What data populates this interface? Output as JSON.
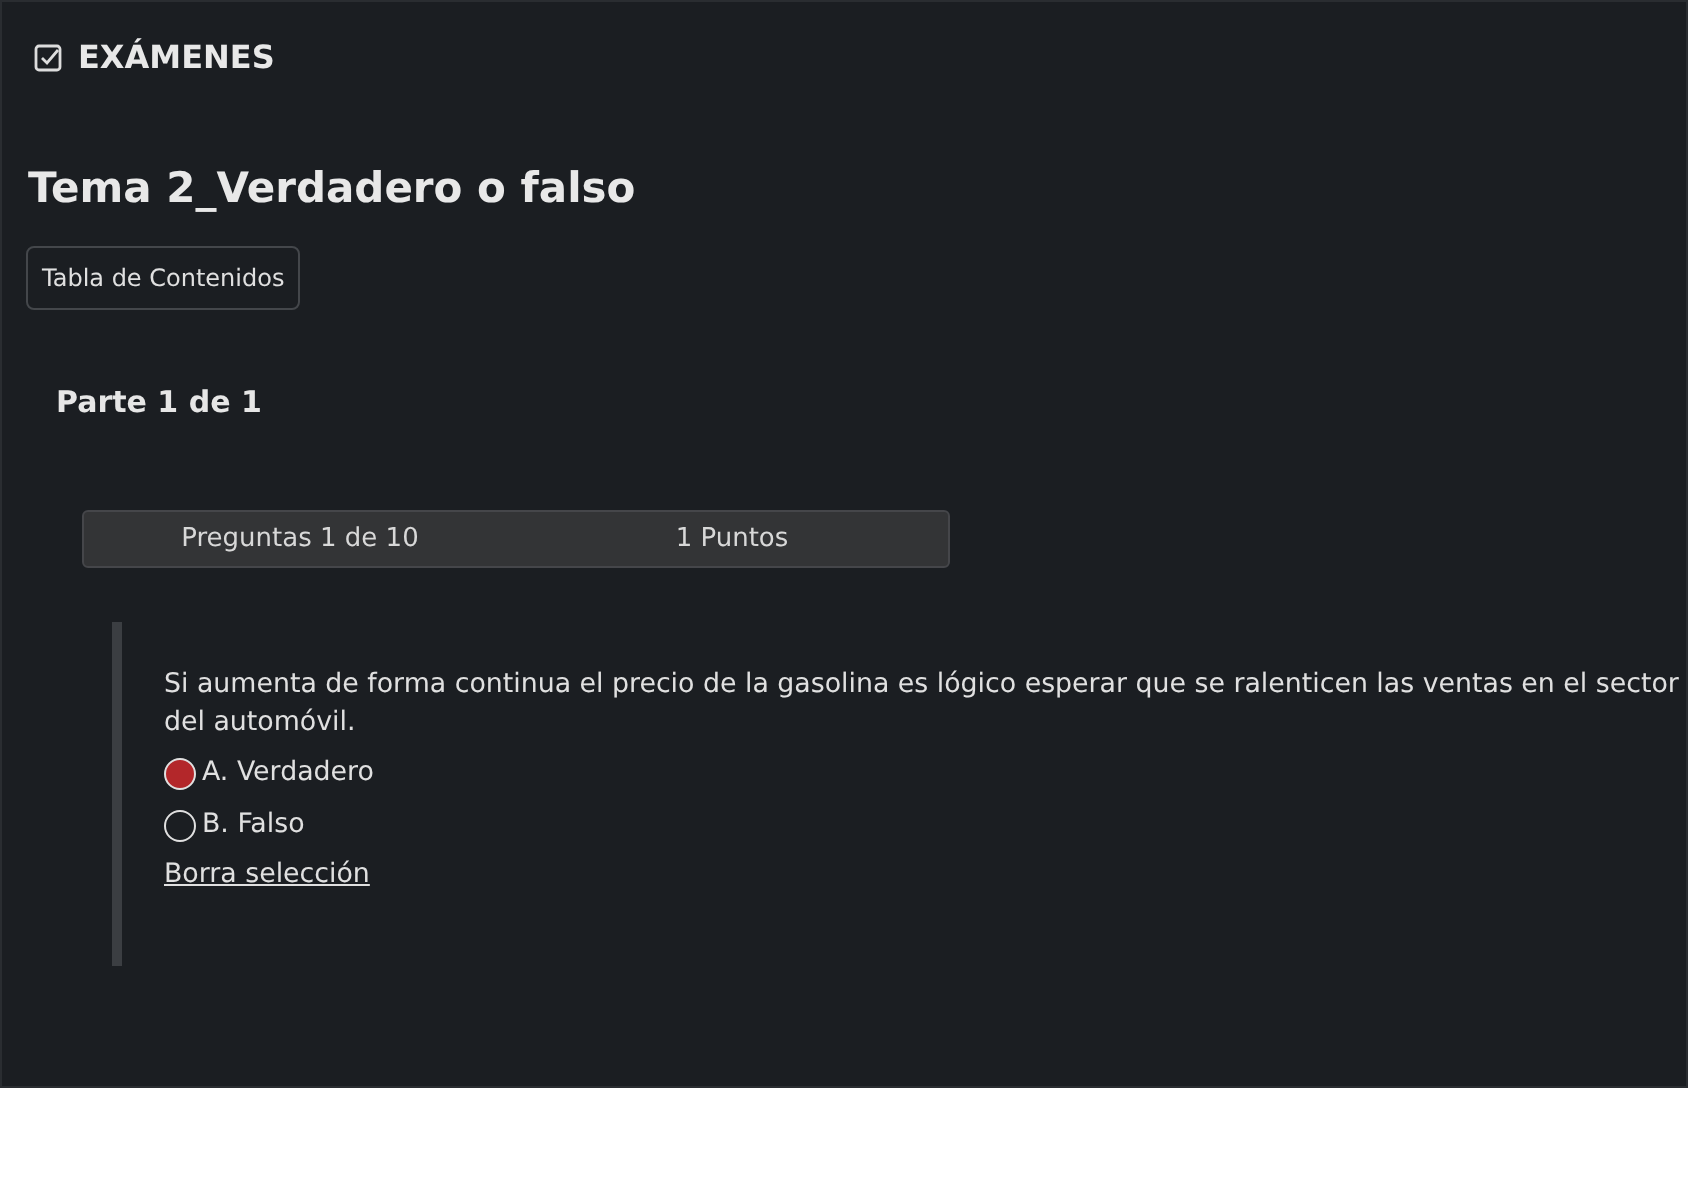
{
  "header": {
    "title": "EXÁMENES"
  },
  "exam": {
    "title": "Tema 2_Verdadero o falso",
    "toc_button": "Tabla de Contenidos",
    "part": "Parte 1 de 1"
  },
  "question_bar": {
    "progress": "Preguntas 1 de 10",
    "points": "1 Puntos"
  },
  "question": {
    "text": "Si aumenta de forma continua el precio de la gasolina es lógico esperar que se ralenticen las ventas en el sector del automóvil.",
    "options": [
      {
        "label": "A. Verdadero",
        "selected": true
      },
      {
        "label": "B. Falso",
        "selected": false
      }
    ],
    "clear_link": "Borra selección"
  }
}
